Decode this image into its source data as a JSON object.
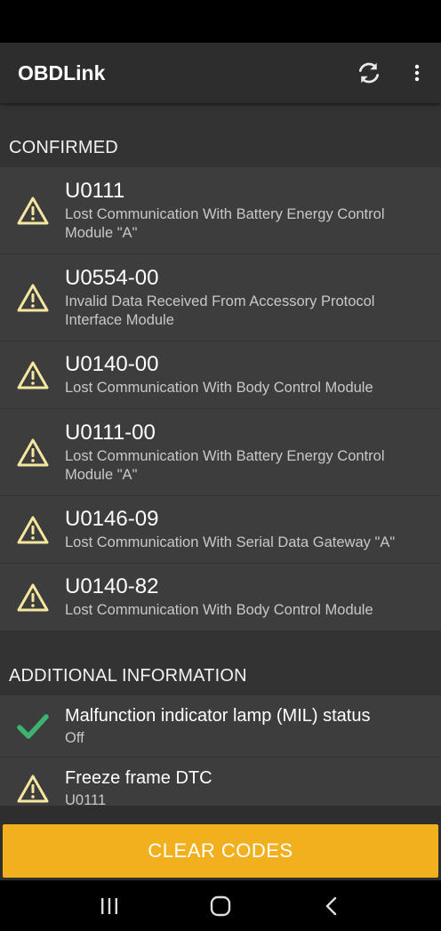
{
  "app": {
    "title": "OBDLink"
  },
  "sections": {
    "confirmed": {
      "title": "CONFIRMED",
      "items": [
        {
          "code": "U0111",
          "description": "Lost Communication With Battery Energy Control Module \"A\""
        },
        {
          "code": "U0554-00",
          "description": "Invalid Data Received From Accessory Protocol Interface Module"
        },
        {
          "code": "U0140-00",
          "description": "Lost Communication With Body Control Module"
        },
        {
          "code": "U0111-00",
          "description": "Lost Communication With Battery Energy Control Module \"A\""
        },
        {
          "code": "U0146-09",
          "description": "Lost Communication With Serial Data Gateway \"A\""
        },
        {
          "code": "U0140-82",
          "description": "Lost Communication With Body Control Module"
        }
      ]
    },
    "additional": {
      "title": "ADDITIONAL INFORMATION",
      "items": [
        {
          "title": "Malfunction indicator lamp (MIL) status",
          "value": "Off",
          "icon": "check-icon"
        },
        {
          "title": "Freeze frame DTC",
          "value": "U0111",
          "icon": "warning-icon"
        }
      ]
    }
  },
  "actions": {
    "clear_codes": "CLEAR CODES"
  },
  "colors": {
    "accent": "#f2b01e",
    "warning": "#f5e6a0",
    "check": "#3cb371",
    "app_bar": "#2d2d2d",
    "list_bg": "#3d3d3d"
  },
  "icons": {
    "refresh": "refresh-icon",
    "menu": "more-vert-icon",
    "nav_recents": "recents-icon",
    "nav_home": "home-icon",
    "nav_back": "back-icon"
  }
}
